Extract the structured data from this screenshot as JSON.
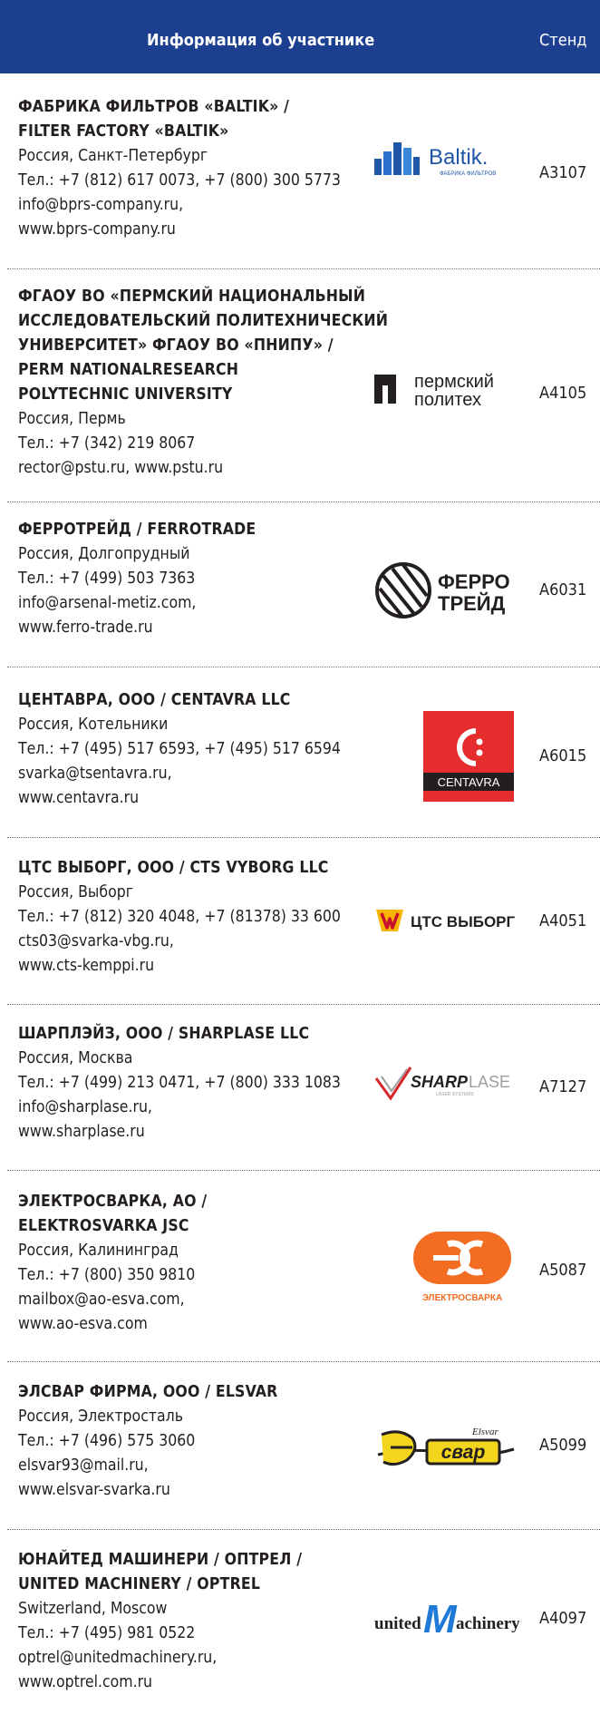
{
  "header": {
    "info": "Информация об участнике",
    "stand": "Стенд"
  },
  "logos": {
    "baltik": {
      "brand": "Baltik.",
      "sub": "ФАБРИКА ФИЛЬТРОВ"
    },
    "permpolytech": {
      "l1": "пермский",
      "l2": "политех"
    },
    "ferrotrade": {
      "l1": "ФЕРРО",
      "l2": "ТРЕЙД"
    },
    "centavra": {
      "text": "CENTAVRA"
    },
    "ctsvyborg": {
      "text": "ЦТС ВЫБОРГ"
    },
    "sharplase": {
      "sharp": "SHARP",
      "lase": "LASE",
      "sub": "LASER SYSTEMS"
    },
    "elektrosvarka": {
      "text": "ЭЛЕКТРОСВАРКА"
    },
    "elsvar": {
      "small": "Elsvar",
      "big": "свар"
    },
    "unitedm": {
      "united": "united",
      "m": "M",
      "achinery": "achinery"
    }
  },
  "entries": [
    {
      "name": "ФАБРИКА ФИЛЬТРОВ «BALTIK» /\nFILTER FACTORY «BALTIK»",
      "lines": [
        "Россия, Санкт-Петербург",
        "Тел.: +7 (812) 617 0073, +7 (800) 300 5773",
        "info@bprs-company.ru,",
        "www.bprs-company.ru"
      ],
      "stand": "A3107"
    },
    {
      "name": "ФГАОУ ВО «ПЕРМСКИЙ НАЦИОНАЛЬНЫЙ\nИССЛЕДОВАТЕЛЬСКИЙ ПОЛИТЕХНИЧЕСКИЙ\nУНИВЕРСИТЕТ» ФГАОУ ВО «ПНИПУ» /\nPERM NATIONALRESEARCH\nPOLYTECHNIC UNIVERSITY",
      "lines": [
        "Россия, Пермь",
        "Тел.: +7 (342) 219 8067",
        "rector@pstu.ru, www.pstu.ru"
      ],
      "stand": "A4105"
    },
    {
      "name": "ФЕРРОТРЕЙД / FERROTRADE",
      "lines": [
        "Россия, Долгопрудный",
        "Тел.: +7 (499) 503 7363",
        "info@arsenal-metiz.com,",
        "www.ferro-trade.ru"
      ],
      "stand": "A6031"
    },
    {
      "name": "ЦЕНТАВРА, ООО / CENTAVRA LLC",
      "lines": [
        "Россия, Котельники",
        "Тел.: +7 (495) 517 6593, +7 (495) 517 6594",
        "svarka@tsentavra.ru,",
        "www.centavra.ru"
      ],
      "stand": "A6015"
    },
    {
      "name": "ЦТС ВЫБОРГ, ООО / CTS VYBORG LLC",
      "lines": [
        "Россия, Выборг",
        "Тел.: +7 (812) 320 4048, +7 (81378) 33 600",
        "cts03@svarka-vbg.ru,",
        "www.cts-kemppi.ru"
      ],
      "stand": "A4051"
    },
    {
      "name": "ШАРПЛЭЙЗ, ООО / SHARPLASE LLC",
      "lines": [
        "Россия, Москва",
        "Тел.: +7 (499) 213 0471, +7 (800) 333 1083",
        "info@sharplase.ru,",
        "www.sharplase.ru"
      ],
      "stand": "A7127"
    },
    {
      "name": "ЭЛЕКТРОСВАРКА, АО /\nELEKTROSVARKA JSC",
      "lines": [
        "Россия, Калининград",
        "Тел.: +7 (800) 350 9810",
        "mailbox@ao-esva.com,",
        "www.ao-esva.com"
      ],
      "stand": "A5087"
    },
    {
      "name": "ЭЛСВАР ФИРМА, ООО / ELSVAR",
      "lines": [
        "Россия, Электросталь",
        "Тел.: +7 (496) 575 3060",
        "elsvar93@mail.ru,",
        "www.elsvar-svarka.ru"
      ],
      "stand": "A5099"
    },
    {
      "name": "ЮНАЙТЕД МАШИНЕРИ / ОПТРЕЛ /\nUNITED MACHINERY / OPTREL",
      "lines": [
        "Switzerland, Moscow",
        "Тел.: +7 (495) 981 0522",
        "optrel@unitedmachinery.ru,",
        "www.optrel.com.ru"
      ],
      "stand": "A4097"
    }
  ],
  "colors": {
    "header_bg": "#1d3f8f",
    "baltik_blue": "#1f56a8",
    "ferro_text": "#231f20",
    "centavra_red": "#e52d2d",
    "cts_yellow": "#f7b500",
    "sharp_red": "#d7262c",
    "esva_orange": "#f26c22",
    "elsvar_yellow": "#f3d51d",
    "united_blue": "#1e7ad6"
  }
}
